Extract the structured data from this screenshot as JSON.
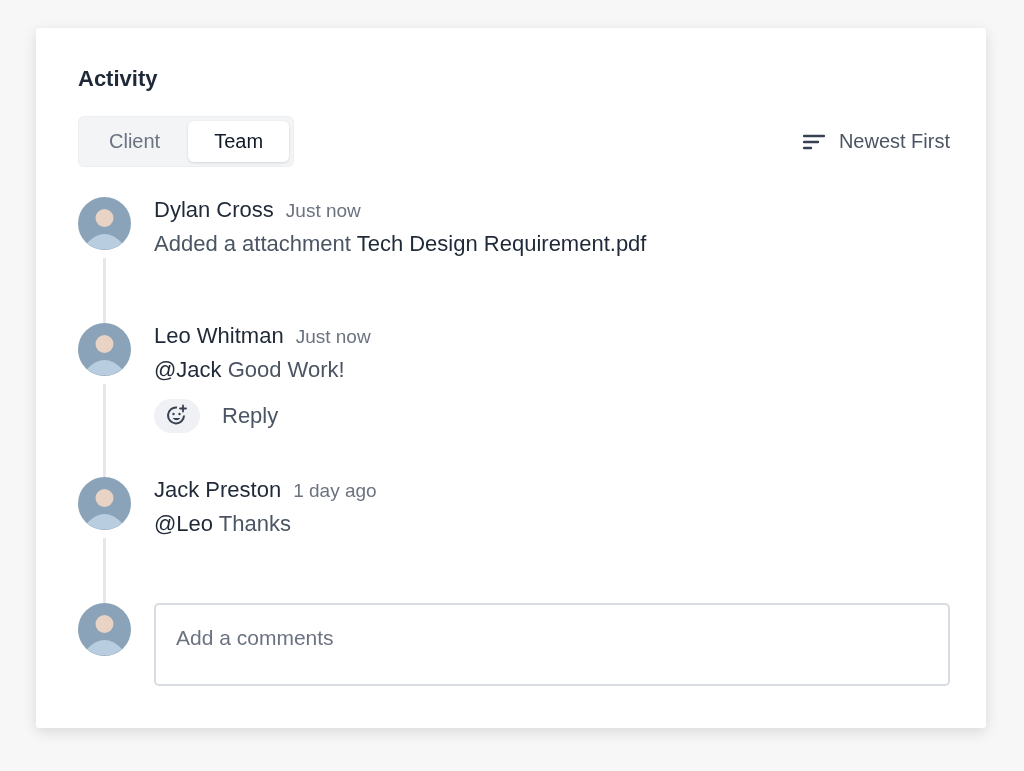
{
  "title": "Activity",
  "tabs": [
    {
      "label": "Client",
      "selected": false
    },
    {
      "label": "Team",
      "selected": true
    }
  ],
  "sort": {
    "label": "Newest First"
  },
  "entries": [
    {
      "name": "Dylan Cross",
      "time": "Just now",
      "message": "Added a attachment **Tech Design Requirement.pdf**"
    },
    {
      "name": "Leo Whitman",
      "time": "Just now",
      "message": "**@Jack** Good Work!",
      "reply": "Reply"
    },
    {
      "name": "Jack Preston",
      "time": "1 day ago",
      "message": "**@Leo** Thanks"
    }
  ],
  "comment": {
    "placeholder": "Add a comments"
  }
}
